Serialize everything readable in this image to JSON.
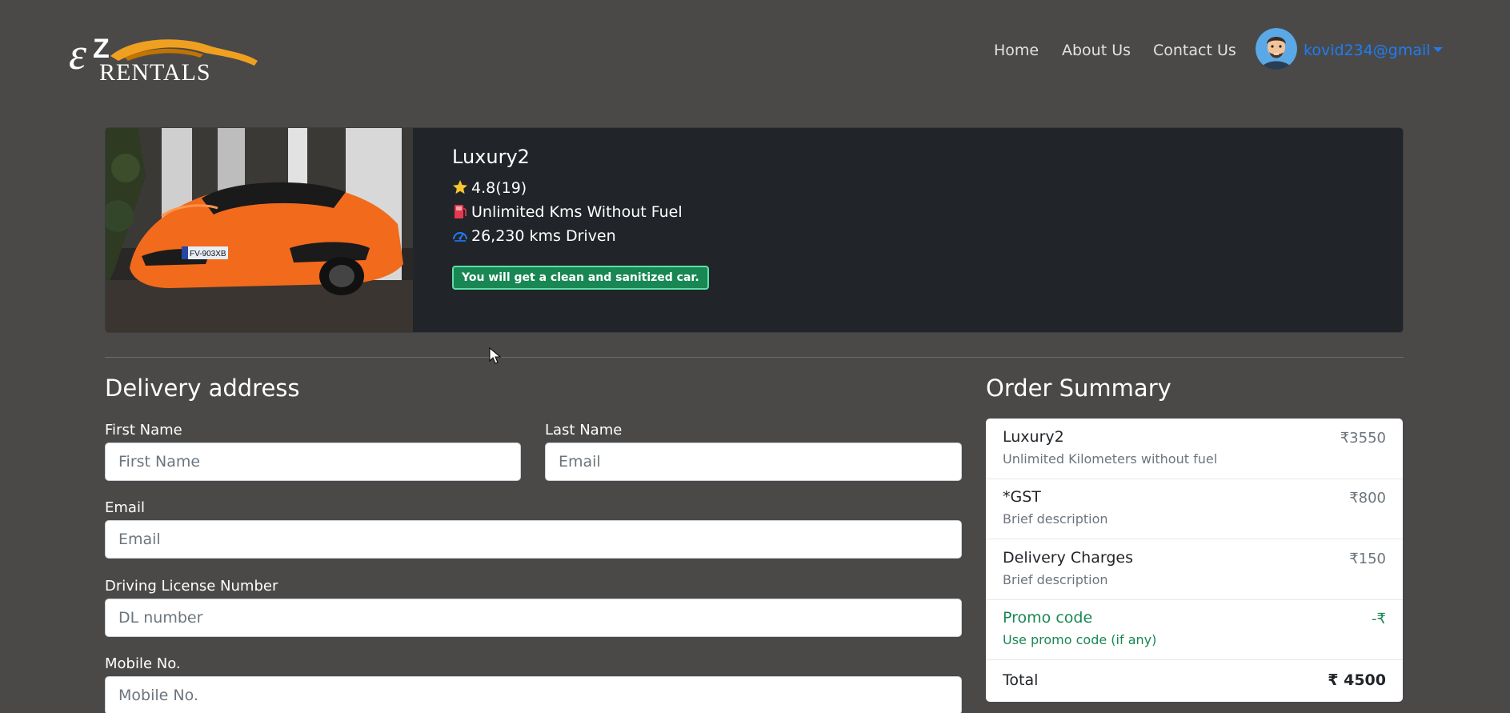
{
  "brand": {
    "logo_text": "EZ RENTALS",
    "logo_accent": "#f0a020"
  },
  "nav": {
    "home": "Home",
    "about": "About Us",
    "contact": "Contact Us",
    "user": "kovid234@gmail",
    "link_color": "#1f7cf5"
  },
  "car": {
    "name": "Luxury2",
    "rating": "4.8(19)",
    "plan": "Unlimited Kms Without Fuel",
    "driven": "26,230 kms Driven",
    "badge": "You will get a clean and sanitized car.",
    "plate": "FV-903XB",
    "body_color": "#f26a1c"
  },
  "delivery": {
    "title": "Delivery address",
    "first_name": {
      "label": "First Name",
      "placeholder": "First Name"
    },
    "last_name": {
      "label": "Last Name",
      "placeholder": "Email"
    },
    "email": {
      "label": "Email",
      "placeholder": "Email"
    },
    "license": {
      "label": "Driving License Number",
      "placeholder": "DL number"
    },
    "mobile": {
      "label": "Mobile No.",
      "placeholder": "Mobile No."
    }
  },
  "summary": {
    "title": "Order Summary",
    "items": [
      {
        "name": "Luxury2",
        "desc": "Unlimited Kilometers without fuel",
        "price": "₹3550"
      },
      {
        "name": "*GST",
        "desc": "Brief description",
        "price": "₹800"
      },
      {
        "name": "Delivery Charges",
        "desc": "Brief description",
        "price": "₹150"
      },
      {
        "name": "Promo code",
        "desc": "Use promo code (if any)",
        "price": "-₹"
      }
    ],
    "total_label": "Total",
    "total_value": "₹ 4500",
    "promo_color": "#198754"
  }
}
